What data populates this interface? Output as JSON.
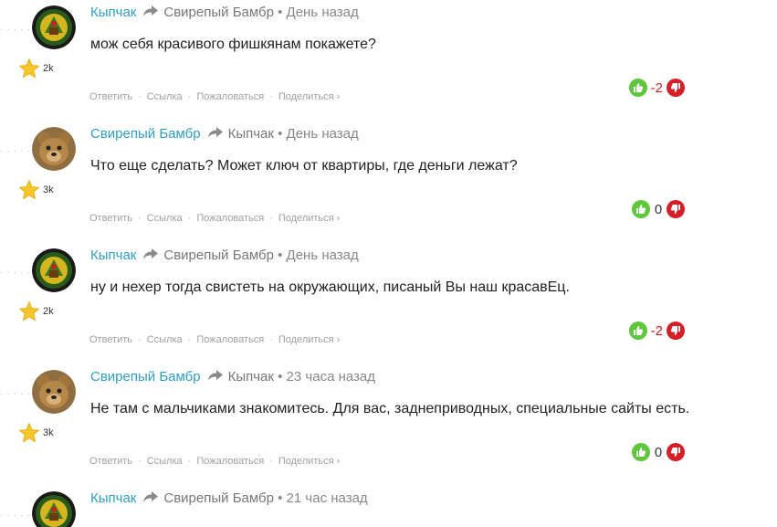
{
  "colors": {
    "author": "#2e9fc2",
    "upvote": "#5ec73c",
    "downvote": "#d51f26",
    "negative_score": "#d51f26"
  },
  "actions": {
    "reply": "Ответить",
    "link": "Ссылка",
    "report": "Пожаловаться",
    "share": "Поделиться ›"
  },
  "comments": [
    {
      "author": "Кыпчак",
      "reply_to": "Свирепый Бамбр",
      "time": "• День назад",
      "text": "мож себя красивого фишкянам покажете?",
      "rating": "2k",
      "score": "-2",
      "avatar": "emblem"
    },
    {
      "author": "Свирепый Бамбр",
      "reply_to": "Кыпчак",
      "time": "• День назад",
      "text": "Что еще сделать? Может ключ от квартиры, где деньги лежат?",
      "rating": "3k",
      "score": "0",
      "avatar": "bear"
    },
    {
      "author": "Кыпчак",
      "reply_to": "Свирепый Бамбр",
      "time": "• День назад",
      "text": "ну и нехер тогда свистеть на окружающих, писаный Вы наш красавЕц.",
      "rating": "2k",
      "score": "-2",
      "avatar": "emblem"
    },
    {
      "author": "Свирепый Бамбр",
      "reply_to": "Кыпчак",
      "time": "• 23 часа назад",
      "text": "Не там с мальчиками знакомитесь. Для вас, заднеприводных, специальные сайты есть.",
      "rating": "3k",
      "score": "0",
      "avatar": "bear"
    },
    {
      "author": "Кыпчак",
      "reply_to": "Свирепый Бамбр",
      "time": "• 21 час назад",
      "avatar": "emblem"
    }
  ]
}
